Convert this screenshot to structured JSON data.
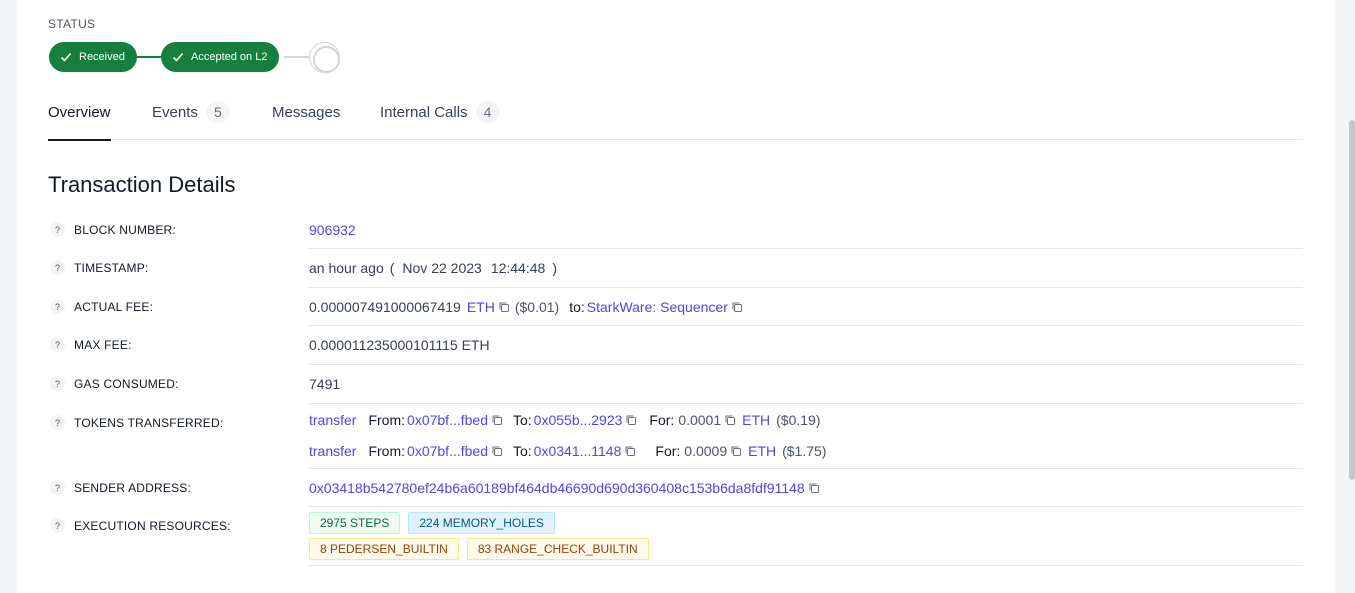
{
  "status": {
    "label": "STATUS",
    "steps": [
      "Received",
      "Accepted on L2"
    ]
  },
  "tabs": [
    {
      "label": "Overview"
    },
    {
      "label": "Events",
      "count": "5"
    },
    {
      "label": "Messages"
    },
    {
      "label": "Internal Calls",
      "count": "4"
    }
  ],
  "details": {
    "title": "Transaction Details",
    "block_number": {
      "label": "BLOCK NUMBER:",
      "value": "906932"
    },
    "timestamp": {
      "label": "TIMESTAMP:",
      "relative": "an hour ago",
      "open": "(",
      "date": "Nov 22 2023",
      "time": "12:44:48",
      "close": ")"
    },
    "actual_fee": {
      "label": "ACTUAL FEE:",
      "amount": "0.000007491000067419",
      "unit": "ETH",
      "usd": "($0.01)",
      "to_label": "to:",
      "to_value": "StarkWare: Sequencer"
    },
    "max_fee": {
      "label": "MAX FEE:",
      "value": "0.000011235000101115 ETH"
    },
    "gas_consumed": {
      "label": "GAS CONSUMED:",
      "value": "7491"
    },
    "tokens_transferred": {
      "label": "TOKENS TRANSFERRED:",
      "transfers": [
        {
          "kind": "transfer",
          "from_label": "From:",
          "from": "0x07bf...fbed",
          "to_label": "To:",
          "to": "0x055b...2923",
          "for_label": "For:",
          "amount": "0.0001",
          "unit": "ETH",
          "usd": "($0.19)"
        },
        {
          "kind": "transfer",
          "from_label": "From:",
          "from": "0x07bf...fbed",
          "to_label": "To:",
          "to": "0x0341...1148",
          "for_label": "For:",
          "amount": "0.0009",
          "unit": "ETH",
          "usd": "($1.75)"
        }
      ]
    },
    "sender_address": {
      "label": "SENDER ADDRESS:",
      "value": "0x03418b542780ef24b6a60189bf464db46690d690d360408c153b6da8fdf91148"
    },
    "execution_resources": {
      "label": "EXECUTION RESOURCES:",
      "badges": [
        "2975 STEPS",
        "224 MEMORY_HOLES",
        "8 PEDERSEN_BUILTIN",
        "83 RANGE_CHECK_BUILTIN"
      ]
    }
  },
  "colors": {
    "success": "#15803d",
    "link": "#4f46e5"
  },
  "icons": [
    "check-icon",
    "help-icon",
    "copy-icon"
  ]
}
